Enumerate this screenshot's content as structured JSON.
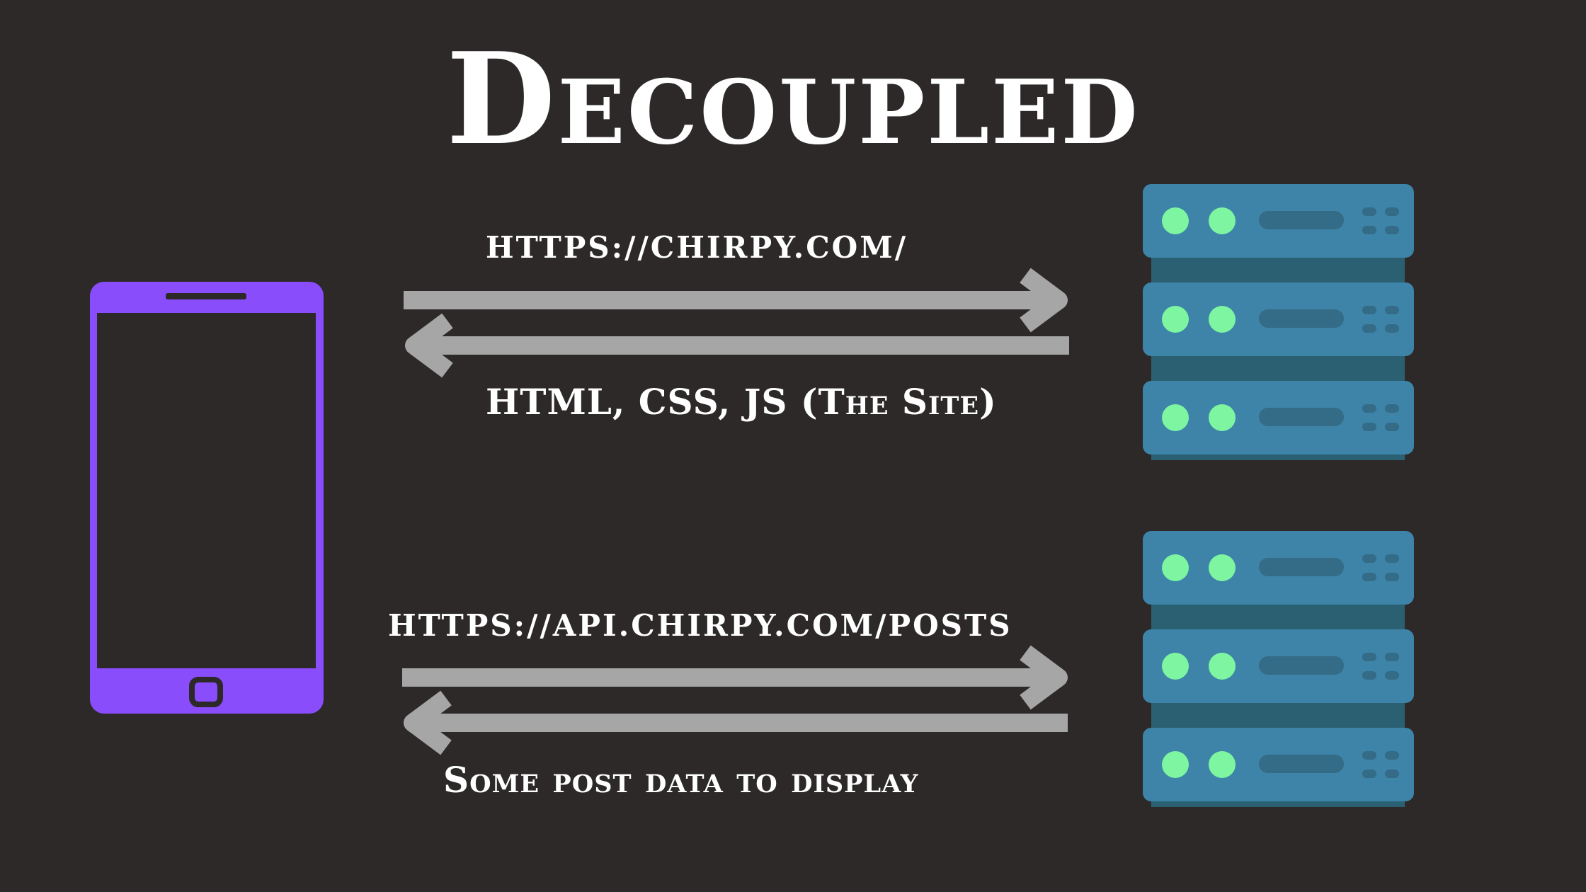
{
  "title": "Decoupled",
  "flows": [
    {
      "request": "https://chirpy.com/",
      "response": "HTML, CSS, JS (The Site)"
    },
    {
      "request": "https://api.chirpy.com/posts",
      "response": "Some post data to display"
    }
  ],
  "icons": {
    "client": "smartphone-icon",
    "server_top": "server-rack-icon",
    "server_bottom": "server-rack-icon"
  },
  "colors": {
    "background": "#2d2929",
    "phone": "#8a4dfc",
    "server_unit": "#3d84a8",
    "server_rack": "#2b6073",
    "server_slot": "#346b86",
    "server_led": "#7ef5a0",
    "arrow": "#a6a6a6",
    "text": "#ffffff"
  }
}
